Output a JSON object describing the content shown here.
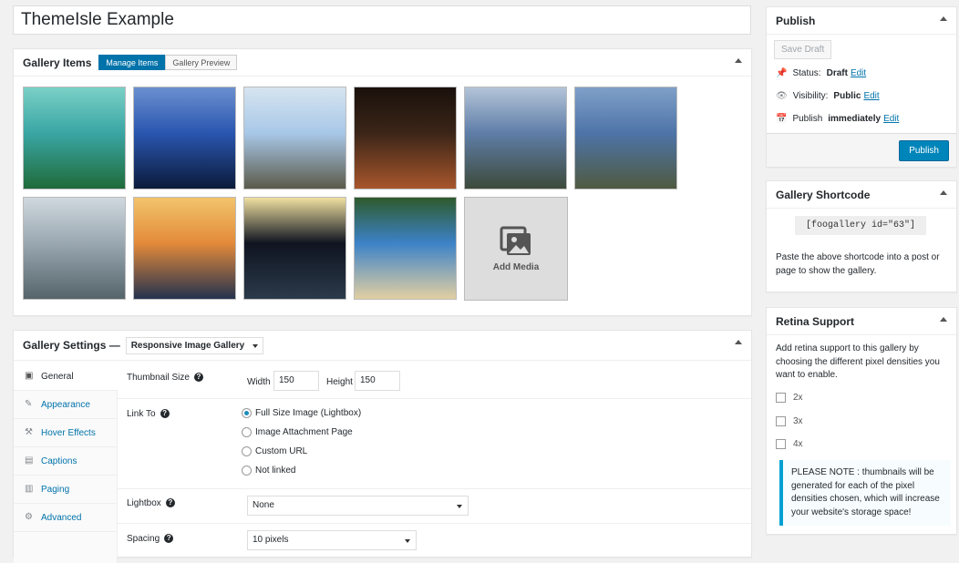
{
  "post_title": "ThemeIsle Example",
  "gallery_items": {
    "title": "Gallery Items",
    "tabs": [
      "Manage Items",
      "Gallery Preview"
    ],
    "add_media_label": "Add Media",
    "images": [
      {
        "name": "tropical-beach",
        "colors": [
          "#3aa6a4",
          "#1f6b3a",
          "#7ad0c6"
        ]
      },
      {
        "name": "hiker-silhouette",
        "colors": [
          "#2a56b0",
          "#0b1b3a",
          "#6b8fcf"
        ]
      },
      {
        "name": "valley-sky",
        "colors": [
          "#a8c8e8",
          "#5b5a4a",
          "#d6e4ef"
        ]
      },
      {
        "name": "night-street",
        "colors": [
          "#3b2518",
          "#a8562b",
          "#1a110c"
        ]
      },
      {
        "name": "mountain-clouds",
        "colors": [
          "#5f7ea8",
          "#3d4a3a",
          "#b4c4d8"
        ]
      },
      {
        "name": "mountain-ridge",
        "colors": [
          "#4e74a8",
          "#4f5a40",
          "#7fa0c8"
        ]
      },
      {
        "name": "stormy-sea",
        "colors": [
          "#9aa8b2",
          "#55636a",
          "#d0d8de"
        ]
      },
      {
        "name": "sunset-shore",
        "colors": [
          "#e38a3a",
          "#24324e",
          "#f2c46b"
        ]
      },
      {
        "name": "night-market",
        "colors": [
          "#0f1420",
          "#2b3a4a",
          "#f0e0a0"
        ]
      },
      {
        "name": "palm-beach",
        "colors": [
          "#3c82c8",
          "#e2cfa2",
          "#2e5a2c"
        ]
      }
    ]
  },
  "gallery_settings": {
    "title": "Gallery Settings —",
    "template": "Responsive Image Gallery",
    "tabs": [
      {
        "label": "General",
        "icon": "settings-icon"
      },
      {
        "label": "Appearance",
        "icon": "brush-icon"
      },
      {
        "label": "Hover Effects",
        "icon": "wrench-icon"
      },
      {
        "label": "Captions",
        "icon": "captions-icon"
      },
      {
        "label": "Paging",
        "icon": "paging-icon"
      },
      {
        "label": "Advanced",
        "icon": "gear-icon"
      }
    ],
    "thumbnail_size": {
      "label": "Thumbnail Size",
      "width_label": "Width",
      "width": "150",
      "height_label": "Height",
      "height": "150"
    },
    "link_to": {
      "label": "Link To",
      "options": [
        "Full Size Image (Lightbox)",
        "Image Attachment Page",
        "Custom URL",
        "Not linked"
      ],
      "selected": 0
    },
    "lightbox": {
      "label": "Lightbox",
      "value": "None"
    },
    "spacing": {
      "label": "Spacing",
      "value": "10 pixels"
    }
  },
  "publish": {
    "title": "Publish",
    "save_draft": "Save Draft",
    "status_label": "Status:",
    "status_value": "Draft",
    "status_edit": "Edit",
    "visibility_label": "Visibility:",
    "visibility_value": "Public",
    "visibility_edit": "Edit",
    "publish_label": "Publish",
    "publish_value": "immediately",
    "publish_edit": "Edit",
    "publish_button": "Publish"
  },
  "shortcode": {
    "title": "Gallery Shortcode",
    "code": "[foogallery id=\"63\"]",
    "description": "Paste the above shortcode into a post or page to show the gallery."
  },
  "retina": {
    "title": "Retina Support",
    "description": "Add retina support to this gallery by choosing the different pixel densities you want to enable.",
    "options": [
      "2x",
      "3x",
      "4x"
    ],
    "note": "PLEASE NOTE : thumbnails will be generated for each of the pixel densities chosen, which will increase your website's storage space!"
  },
  "colors": {
    "accent": "#0073aa",
    "publish_button": "#0085ba"
  }
}
